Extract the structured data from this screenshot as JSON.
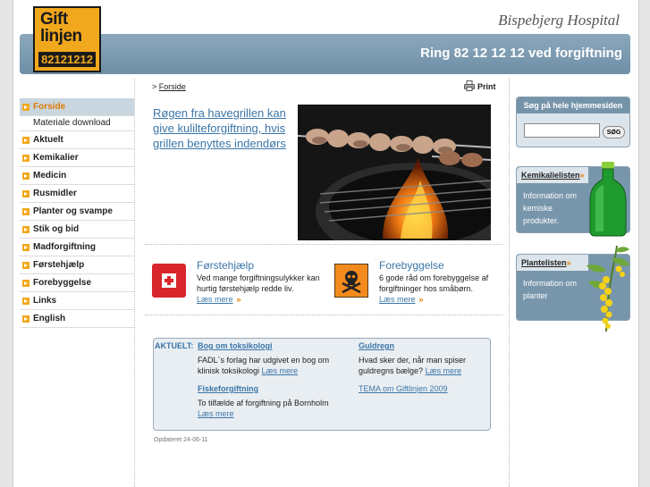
{
  "header": {
    "logo_line1": "Gift",
    "logo_line2": "linjen",
    "logo_number": "82121212",
    "hospital": "Bispebjerg Hospital",
    "phone_banner": "Ring 82 12 12 12 ved forgiftning"
  },
  "nav": {
    "items": [
      {
        "label": "Forside",
        "active": true
      },
      {
        "label": "Materiale download",
        "sub": true
      },
      {
        "label": "Aktuelt"
      },
      {
        "label": "Kemikalier"
      },
      {
        "label": "Medicin"
      },
      {
        "label": "Rusmidler"
      },
      {
        "label": "Planter og svampe"
      },
      {
        "label": "Stik og bid"
      },
      {
        "label": "Madforgiftning"
      },
      {
        "label": "Førstehjælp"
      },
      {
        "label": "Forebyggelse"
      },
      {
        "label": "Links"
      },
      {
        "label": "English"
      }
    ]
  },
  "breadcrumb": {
    "prefix": ">",
    "home": "Forside"
  },
  "print_label": "Print",
  "feature": {
    "headline": "Røgen fra havegrillen kan give kulilteforgiftning, hvis grillen benyttes indendørs"
  },
  "promos": {
    "first_aid": {
      "title": "Førstehjælp",
      "text": "Ved mange forgiftningsulykker kan hurtig førstehjælp redde liv.",
      "more": "Læs mere"
    },
    "prevention": {
      "title": "Forebyggelse",
      "text": "6 gode råd om forebyggelse af forgiftninger hos småbørn.",
      "more": "Læs mere"
    }
  },
  "news": {
    "label": "AKTUELT:",
    "items": [
      {
        "title": "Bog om toksikologi",
        "text": "FADL`s forlag har udgivet en bog om klinisk toksikologi",
        "more": "Læs mere"
      },
      {
        "title": "Fiskeforgiftning",
        "text": "To tilfælde af forgiftning på Bornholm",
        "more": "Læs mere"
      },
      {
        "title": "Guldregn",
        "text": "Hvad sker der, når man spiser guldregns bælge?",
        "more": "Læs mere"
      }
    ],
    "theme_link": "TEMA om Giftlinjen 2009"
  },
  "updated": "Opdateret 24-06-11",
  "search": {
    "title": "Søg på hele hjemmesiden",
    "value": "",
    "button": "SØG"
  },
  "sidebar_boxes": {
    "chemicals": {
      "title": "Kemikalielisten",
      "text": "Information om kemiske produkter."
    },
    "plants": {
      "title": "Plantelisten",
      "text": "Information om planter"
    }
  },
  "colors": {
    "accent_orange": "#f2a81d",
    "link_blue": "#3b76a8",
    "banner_blue": "#7594aa"
  }
}
